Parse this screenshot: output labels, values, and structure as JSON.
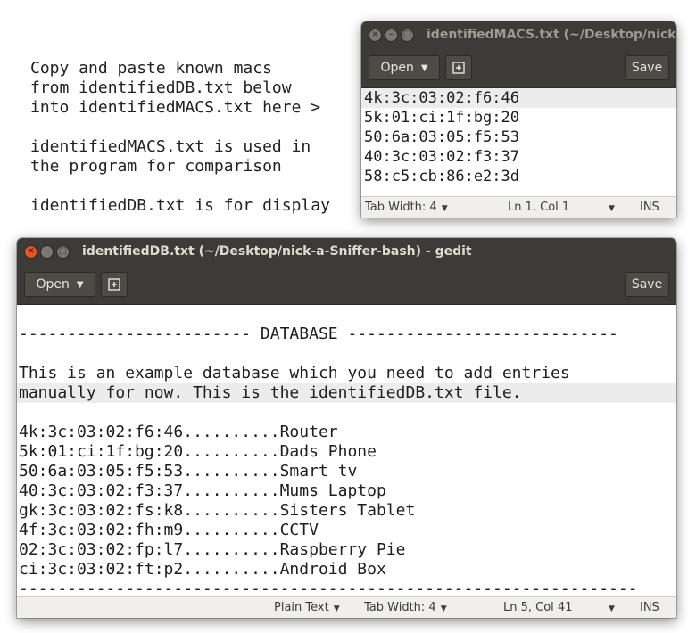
{
  "note": {
    "lines": [
      "Copy and paste known macs",
      "from identifiedDB.txt below",
      "into identifiedMACS.txt here >",
      "",
      "identifiedMACS.txt is used in",
      "the program for comparison",
      "",
      "identifiedDB.txt is for display"
    ]
  },
  "macs_window": {
    "title": "identifiedMACS.txt (~/Desktop/nick-a",
    "open_label": "Open",
    "save_label": "Save",
    "lines": [
      "4k:3c:03:02:f6:46",
      "5k:01:ci:1f:bg:20",
      "50:6a:03:05:f5:53",
      "40:3c:03:02:f3:37",
      "58:c5:cb:86:e2:3d"
    ],
    "status": {
      "tab_width": "Tab Width: 4",
      "position": "Ln 1, Col 1",
      "mode": "INS"
    }
  },
  "db_window": {
    "title": "identifiedDB.txt (~/Desktop/nick-a-Sniffer-bash) - gedit",
    "open_label": "Open",
    "save_label": "Save",
    "lines": [
      "",
      "------------------------ DATABASE ----------------------------",
      "",
      "This is an example database which you need to add entries",
      "manually for now. This is the identifiedDB.txt file.",
      "",
      "4k:3c:03:02:f6:46..........Router",
      "5k:01:ci:1f:bg:20..........Dads Phone",
      "50:6a:03:05:f5:53..........Smart tv",
      "40:3c:03:02:f3:37..........Mums Laptop",
      "gk:3c:03:02:fs:k8..........Sisters Tablet",
      "4f:3c:03:02:fh:m9..........CCTV",
      "02:3c:03:02:fp:l7..........Raspberry Pie",
      "ci:3c:03:02:ft:p2..........Android Box",
      "----------------------------------------------------------------"
    ],
    "status": {
      "language": "Plain Text",
      "tab_width": "Tab Width: 4",
      "position": "Ln 5, Col 41",
      "mode": "INS"
    }
  }
}
